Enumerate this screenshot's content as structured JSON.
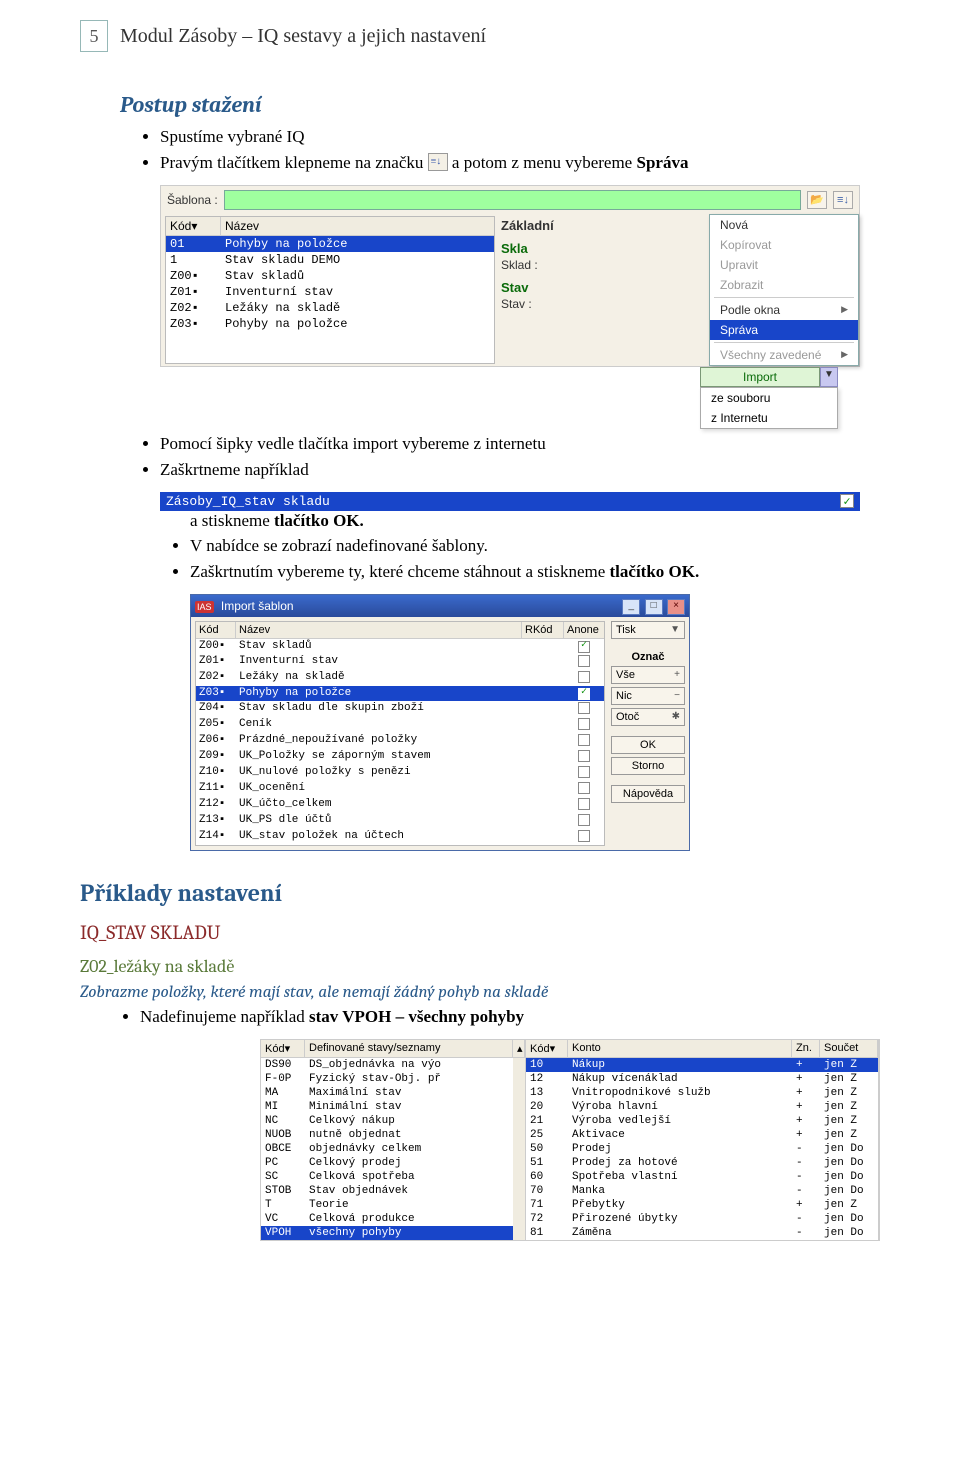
{
  "page_number": "5",
  "doc_title": "Modul Zásoby – IQ sestavy a jejich nastavení",
  "headings": {
    "postup_stazeni": "Postup stažení",
    "priklady": "Příklady nastavení",
    "iq_stav": "IQ_STAV SKLADU",
    "z02": "Z02_ležáky na skladě",
    "zobrazme": "Zobrazme položky, které mají stav, ale nemají žádný pohyb na skladě"
  },
  "bullets": {
    "b1a": "Spustíme vybrané IQ",
    "b1b_pre": "Pravým tlačítkem klepneme na značku ",
    "b1b_post": " a potom z menu vybereme ",
    "b1b_bold": "Správa",
    "b2": "Pomocí šipky vedle tlačítka import vybereme z internetu",
    "b3": "Zaškrtneme například",
    "b4_pre": "a stiskneme ",
    "b4_bold": "tlačítko OK.",
    "b5": "V nabídce se zobrazí nadefinované šablony.",
    "b6_pre": "Zaškrtnutím vybereme ty, které chceme stáhnout a stiskneme ",
    "b6_bold": "tlačítko OK.",
    "b7_pre": "Nadefinujeme například ",
    "b7_bold": "stav VPOH – všechny pohyby"
  },
  "shot1": {
    "sablona_label": "Šablona :",
    "head_kod": "Kód▾",
    "head_nazev": "Název",
    "rows": [
      {
        "kod": "01",
        "naz": "Pohyby na položce",
        "sel": true
      },
      {
        "kod": "1",
        "naz": "Stav skladu DEMO"
      },
      {
        "kod": "Z00▪",
        "naz": "Stav skladů"
      },
      {
        "kod": "Z01▪",
        "naz": "Inventurní stav"
      },
      {
        "kod": "Z02▪",
        "naz": "Ležáky na skladě"
      },
      {
        "kod": "Z03▪",
        "naz": "Pohyby na položce"
      }
    ],
    "tab_zakladni": "Základní",
    "grp_skla": "Skla",
    "fld_sklad": "Sklad :",
    "grp_stav": "Stav",
    "fld_stav": "Stav :",
    "menu": {
      "nova": "Nová",
      "kopirovat": "Kopírovat",
      "upravit": "Upravit",
      "zobrazit": "Zobrazit",
      "podle_okna": "Podle okna",
      "sprava": "Správa",
      "vsechny": "Všechny zavedené"
    }
  },
  "import_dd": {
    "btn": "Import",
    "ze_souboru": "ze souboru",
    "z_internetu": "z Internetu"
  },
  "chk_strip": "Zásoby_IQ_stav skladu",
  "shot2": {
    "title": "Import šablon",
    "head_kod": "Kód",
    "head_nazev": "Název",
    "head_rkod": "RKód",
    "head_anone": "Anone",
    "rows": [
      {
        "kod": "Z00▪",
        "naz": "Stav skladů",
        "chk": true
      },
      {
        "kod": "Z01▪",
        "naz": "Inventurní stav",
        "chk": false
      },
      {
        "kod": "Z02▪",
        "naz": "Ležáky na skladě",
        "chk": false
      },
      {
        "kod": "Z03▪",
        "naz": "Pohyby na položce",
        "chk": true,
        "sel": true
      },
      {
        "kod": "Z04▪",
        "naz": "Stav skladu dle skupin zboží",
        "chk": false
      },
      {
        "kod": "Z05▪",
        "naz": "Ceník",
        "chk": false
      },
      {
        "kod": "Z06▪",
        "naz": "Prázdné_nepoužívané položky",
        "chk": false
      },
      {
        "kod": "Z09▪",
        "naz": "UK_Položky se záporným stavem",
        "chk": false
      },
      {
        "kod": "Z10▪",
        "naz": "UK_nulové položky s penězi",
        "chk": false
      },
      {
        "kod": "Z11▪",
        "naz": "UK_ocenění",
        "chk": false
      },
      {
        "kod": "Z12▪",
        "naz": "UK_účto_celkem",
        "chk": false
      },
      {
        "kod": "Z13▪",
        "naz": "UK_PS dle účtů",
        "chk": false
      },
      {
        "kod": "Z14▪",
        "naz": "UK_stav položek na účtech",
        "chk": false
      }
    ],
    "btn_tisk": "Tisk",
    "grp_oznac": "Označ",
    "btn_vse": "Vše",
    "btn_nic": "Nic",
    "btn_otoc": "Otoč",
    "btn_ok": "OK",
    "btn_storno": "Storno",
    "btn_napoveda": "Nápověda"
  },
  "shot3": {
    "left": {
      "head_kod": "Kód▾",
      "head_def": "Definované stavy/seznamy",
      "rows": [
        {
          "kod": "DS90",
          "def": "DS_objednávka na výo"
        },
        {
          "kod": "F-0P",
          "def": "Fyzický stav-Obj. př"
        },
        {
          "kod": "MA",
          "def": "Maximální stav"
        },
        {
          "kod": "MI",
          "def": "Minimální stav"
        },
        {
          "kod": "NC",
          "def": "Celkový nákup"
        },
        {
          "kod": "NUOB",
          "def": "nutně objednat"
        },
        {
          "kod": "OBCE",
          "def": "objednávky celkem"
        },
        {
          "kod": "PC",
          "def": "Celkový prodej"
        },
        {
          "kod": "SC",
          "def": "Celková spotřeba"
        },
        {
          "kod": "STOB",
          "def": "Stav objednávek"
        },
        {
          "kod": "T",
          "def": "Teorie"
        },
        {
          "kod": "VC",
          "def": "Celková produkce"
        },
        {
          "kod": "VPOH",
          "def": "všechny pohyby",
          "sel": true
        }
      ]
    },
    "right": {
      "head_kod": "Kód▾",
      "head_konto": "Konto",
      "head_zn": "Zn.",
      "head_soucet": "Součet",
      "rows": [
        {
          "kod": "10",
          "konto": "Nákup",
          "zn": "+",
          "souc": "jen Z",
          "sel": true
        },
        {
          "kod": "12",
          "konto": "Nákup vícenáklad",
          "zn": "+",
          "souc": "jen Z"
        },
        {
          "kod": "13",
          "konto": "Vnitropodnikové služb",
          "zn": "+",
          "souc": "jen Z"
        },
        {
          "kod": "20",
          "konto": "Výroba hlavní",
          "zn": "+",
          "souc": "jen Z"
        },
        {
          "kod": "21",
          "konto": "Výroba vedlejší",
          "zn": "+",
          "souc": "jen Z"
        },
        {
          "kod": "25",
          "konto": "Aktivace",
          "zn": "+",
          "souc": "jen Z"
        },
        {
          "kod": "50",
          "konto": "Prodej",
          "zn": "-",
          "souc": "jen Do"
        },
        {
          "kod": "51",
          "konto": "Prodej za hotové",
          "zn": "-",
          "souc": "jen Do"
        },
        {
          "kod": "60",
          "konto": "Spotřeba vlastní",
          "zn": "-",
          "souc": "jen Do"
        },
        {
          "kod": "70",
          "konto": "Manka",
          "zn": "-",
          "souc": "jen Do"
        },
        {
          "kod": "71",
          "konto": "Přebytky",
          "zn": "+",
          "souc": "jen Z"
        },
        {
          "kod": "72",
          "konto": "Přirozené úbytky",
          "zn": "-",
          "souc": "jen Do"
        },
        {
          "kod": "81",
          "konto": "Záměna",
          "zn": "-",
          "souc": "jen Do"
        }
      ]
    }
  }
}
